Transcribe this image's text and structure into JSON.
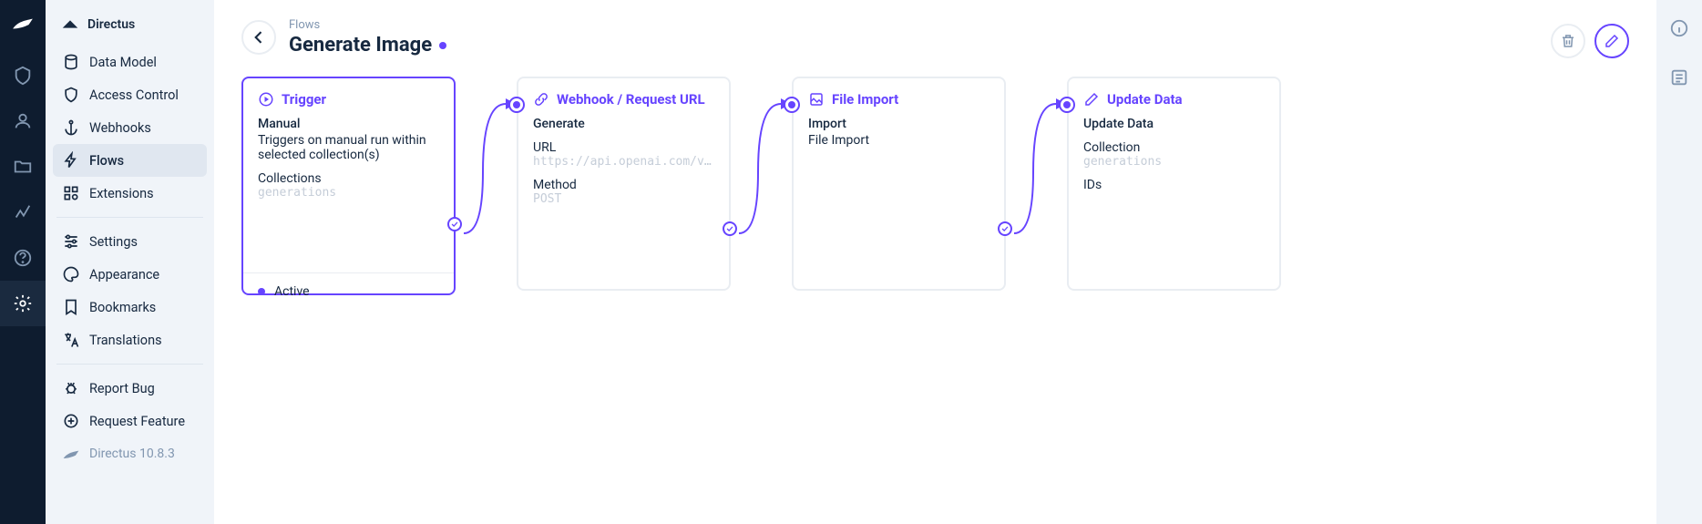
{
  "app_name": "Directus",
  "version": "Directus 10.8.3",
  "breadcrumb": "Flows",
  "page_title": "Generate Image",
  "sidebar": {
    "items": [
      {
        "label": "Data Model"
      },
      {
        "label": "Access Control"
      },
      {
        "label": "Webhooks"
      },
      {
        "label": "Flows"
      },
      {
        "label": "Extensions"
      },
      {
        "label": "Settings"
      },
      {
        "label": "Appearance"
      },
      {
        "label": "Bookmarks"
      },
      {
        "label": "Translations"
      },
      {
        "label": "Report Bug"
      },
      {
        "label": "Request Feature"
      }
    ]
  },
  "flow": {
    "trigger": {
      "title": "Trigger",
      "type": "Manual",
      "description": "Triggers on manual run within selected collection(s)",
      "collections_label": "Collections",
      "collections_value": "generations",
      "status": "Active"
    },
    "ops": [
      {
        "title": "Webhook / Request URL",
        "name": "Generate",
        "url_label": "URL",
        "url_value": "https://api.openai.com/v1/…",
        "method_label": "Method",
        "method_value": "POST"
      },
      {
        "title": "File Import",
        "name": "Import",
        "sub_label": "File Import"
      },
      {
        "title": "Update Data",
        "name": "Update Data",
        "collection_label": "Collection",
        "collection_value": "generations",
        "ids_label": "IDs"
      }
    ]
  }
}
